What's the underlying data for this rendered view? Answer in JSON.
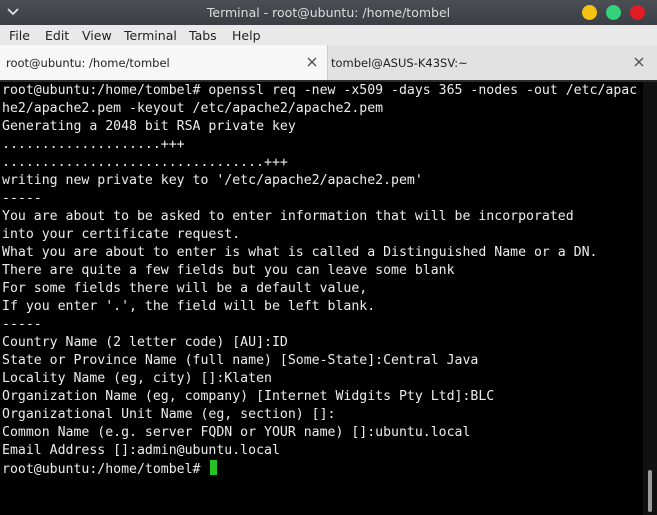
{
  "window": {
    "title": "Terminal - root@ubuntu: /home/tombel"
  },
  "menu": [
    "File",
    "Edit",
    "View",
    "Terminal",
    "Tabs",
    "Help"
  ],
  "tabs": [
    {
      "label": "root@ubuntu: /home/tombel",
      "active": true
    },
    {
      "label": "tombel@ASUS-K43SV:~",
      "active": false
    }
  ],
  "terminal": {
    "lines": [
      "root@ubuntu:/home/tombel# openssl req -new -x509 -days 365 -nodes -out /etc/apac",
      "he2/apache2.pem -keyout /etc/apache2/apache2.pem",
      "Generating a 2048 bit RSA private key",
      "....................+++",
      ".................................+++",
      "writing new private key to '/etc/apache2/apache2.pem'",
      "-----",
      "You are about to be asked to enter information that will be incorporated",
      "into your certificate request.",
      "What you are about to enter is what is called a Distinguished Name or a DN.",
      "There are quite a few fields but you can leave some blank",
      "For some fields there will be a default value,",
      "If you enter '.', the field will be left blank.",
      "-----",
      "Country Name (2 letter code) [AU]:ID",
      "State or Province Name (full name) [Some-State]:Central Java",
      "Locality Name (eg, city) []:Klaten",
      "Organization Name (eg, company) [Internet Widgits Pty Ltd]:BLC",
      "Organizational Unit Name (eg, section) []:",
      "Common Name (e.g. server FQDN or YOUR name) []:ubuntu.local",
      "Email Address []:admin@ubuntu.local"
    ],
    "prompt": "root@ubuntu:/home/tombel# "
  },
  "colors": {
    "cursor": "#22c322",
    "minimize": "#f5c211",
    "maximize": "#33d17a",
    "close": "#e01b24"
  },
  "icons": [
    "chevron-down-icon",
    "close-icon"
  ]
}
